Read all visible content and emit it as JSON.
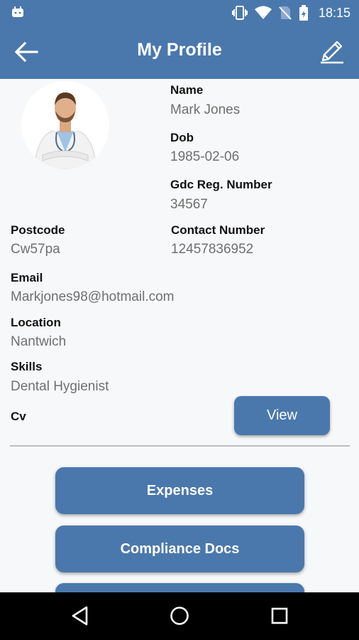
{
  "status_bar": {
    "time": "18:15",
    "icons": [
      "android-icon",
      "vibrate-icon",
      "wifi-icon",
      "no-sim-icon",
      "battery-icon"
    ]
  },
  "toolbar": {
    "title": "My Profile",
    "back_icon": "arrow-left-icon",
    "edit_icon": "pencil-icon"
  },
  "profile": {
    "name_label": "Name",
    "name_value": "Mark Jones",
    "dob_label": "Dob",
    "dob_value": "1985-02-06",
    "gdc_label": "Gdc Reg. Number",
    "gdc_value": "34567",
    "postcode_label": "Postcode",
    "postcode_value": "Cw57pa",
    "contact_label": "Contact Number",
    "contact_value": "12457836952",
    "email_label": "Email",
    "email_value": "Markjones98@hotmail.com",
    "location_label": "Location",
    "location_value": "Nantwich",
    "skills_label": "Skills",
    "skills_value": "Dental Hygienist",
    "cv_label": "Cv",
    "cv_button": "View"
  },
  "menu": {
    "expenses": "Expenses",
    "compliance": "Compliance Docs"
  },
  "colors": {
    "primary": "#4a78ad",
    "label": "#111111",
    "value": "#6f6f6f",
    "background": "#f7f8fa"
  }
}
